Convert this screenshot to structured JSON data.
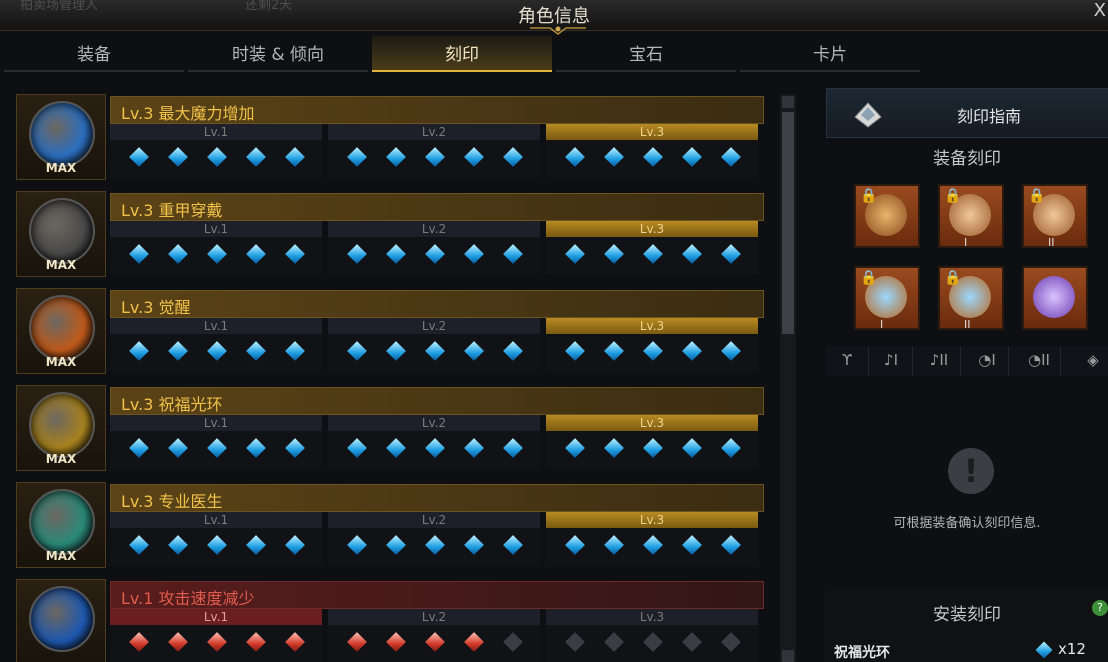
{
  "window": {
    "title": "角色信息",
    "close_label": "X",
    "bg_left": "拍卖场管理人",
    "bg_right": "还剩2天"
  },
  "tabs": [
    {
      "label": "装备",
      "active": false
    },
    {
      "label": "时装 & 倾向",
      "active": false
    },
    {
      "label": "刻印",
      "active": true
    },
    {
      "label": "宝石",
      "active": false
    },
    {
      "label": "卡片",
      "active": false
    }
  ],
  "engravings": [
    {
      "name": "Lv.3 最大魔力增加",
      "badge": "MAX",
      "level": 3,
      "state": "positive",
      "tiers": [
        "Lv.1",
        "Lv.2",
        "Lv.3"
      ],
      "gems_filled": 15,
      "orb": "#2b6fc0"
    },
    {
      "name": "Lv.3 重甲穿戴",
      "badge": "MAX",
      "level": 3,
      "state": "positive",
      "tiers": [
        "Lv.1",
        "Lv.2",
        "Lv.3"
      ],
      "gems_filled": 15,
      "orb": "#4a4a4a"
    },
    {
      "name": "Lv.3 觉醒",
      "badge": "MAX",
      "level": 3,
      "state": "positive",
      "tiers": [
        "Lv.1",
        "Lv.2",
        "Lv.3"
      ],
      "gems_filled": 15,
      "orb": "#c05a1a"
    },
    {
      "name": "Lv.3 祝福光环",
      "badge": "MAX",
      "level": 3,
      "state": "positive",
      "tiers": [
        "Lv.1",
        "Lv.2",
        "Lv.3"
      ],
      "gems_filled": 15,
      "orb": "#a8821e"
    },
    {
      "name": "Lv.3 专业医生",
      "badge": "MAX",
      "level": 3,
      "state": "positive",
      "tiers": [
        "Lv.1",
        "Lv.2",
        "Lv.3"
      ],
      "gems_filled": 15,
      "orb": "#2a8a7a"
    },
    {
      "name": "Lv.1 攻击速度减少",
      "badge": "",
      "level": 1,
      "state": "negative",
      "tiers": [
        "Lv.1",
        "Lv.2",
        "Lv.3"
      ],
      "gems_filled": 9,
      "orb": "#1e58b0"
    }
  ],
  "right": {
    "guide_label": "刻印指南",
    "equip_title": "装备刻印",
    "equip_slots": [
      {
        "name": "necklace",
        "locked": true,
        "roman": ""
      },
      {
        "name": "earring-1",
        "locked": true,
        "roman": "I"
      },
      {
        "name": "earring-2",
        "locked": true,
        "roman": "II"
      },
      {
        "name": "ring-1",
        "locked": true,
        "roman": "I"
      },
      {
        "name": "ring-2",
        "locked": true,
        "roman": "II"
      },
      {
        "name": "stone",
        "locked": false,
        "roman": ""
      }
    ],
    "slot_icons": [
      "necklace-icon",
      "earring-1-icon",
      "earring-2-icon",
      "ring-1-icon",
      "ring-2-icon",
      "stone-icon"
    ],
    "slot_marks": [
      "",
      "I",
      "II",
      "I",
      "II",
      ""
    ],
    "info_text": "可根据装备确认刻印信息.",
    "install_title": "安装刻印",
    "help_label": "?",
    "installed": [
      {
        "name": "祝福光环",
        "count": "x12"
      }
    ]
  },
  "colors": {
    "accent": "#e2b23a",
    "gem_blue": "#1e9fe3",
    "gem_red": "#d23a2a",
    "negative_text": "#e35b4d"
  }
}
